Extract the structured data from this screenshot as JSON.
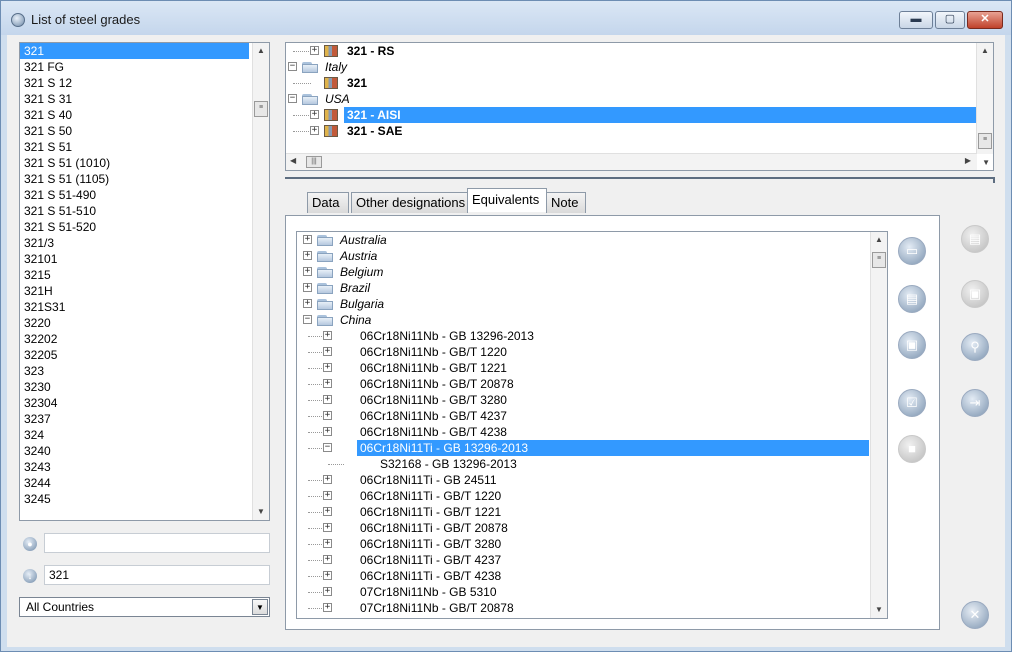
{
  "window": {
    "title": "List of steel grades",
    "controls": {
      "minimize": "▬",
      "maximize": "▢",
      "close": "✕"
    }
  },
  "grades_list": {
    "selected": "321",
    "items": [
      "321",
      "321 FG",
      "321 S 12",
      "321 S 31",
      "321 S 40",
      "321 S 50",
      "321 S 51",
      "321 S 51 (1010)",
      "321 S 51 (1105)",
      "321 S 51-490",
      "321 S 51-510",
      "321 S 51-520",
      "321/3",
      "32101",
      "3215",
      "321H",
      "321S31",
      "3220",
      "32202",
      "32205",
      "323",
      "3230",
      "32304",
      "3237",
      "324",
      "3240",
      "3243",
      "3244",
      "3245"
    ]
  },
  "search": {
    "icon": "magnifier-icon",
    "value": ""
  },
  "grade_field": {
    "icon": "down-arrow-icon",
    "value": "321"
  },
  "country_filter": {
    "value": "All Countries"
  },
  "designation_tree": {
    "nodes": [
      {
        "level": 1,
        "kind": "grade",
        "expanded": false,
        "text": "321  -  RS",
        "bold": true,
        "partial": true
      },
      {
        "level": 0,
        "kind": "country",
        "expanded": true,
        "text": "Italy",
        "italic": true
      },
      {
        "level": 1,
        "kind": "grade",
        "expanded": null,
        "text": "321",
        "bold": true
      },
      {
        "level": 0,
        "kind": "country",
        "expanded": true,
        "text": "USA",
        "italic": true
      },
      {
        "level": 1,
        "kind": "grade",
        "expanded": false,
        "text": "321  -  AISI",
        "bold": true,
        "selected": true
      },
      {
        "level": 1,
        "kind": "grade",
        "expanded": false,
        "text": "321  -  SAE",
        "bold": true
      }
    ]
  },
  "tabs": [
    {
      "label": "Data",
      "active": false
    },
    {
      "label": "Other designations",
      "active": false
    },
    {
      "label": "Equivalents",
      "active": true
    },
    {
      "label": "Note",
      "active": false
    }
  ],
  "equivalents_tree": {
    "nodes": [
      {
        "level": 0,
        "kind": "country",
        "expanded": false,
        "text": "Australia"
      },
      {
        "level": 0,
        "kind": "country",
        "expanded": false,
        "text": "Austria"
      },
      {
        "level": 0,
        "kind": "country",
        "expanded": false,
        "text": "Belgium"
      },
      {
        "level": 0,
        "kind": "country",
        "expanded": false,
        "text": "Brazil"
      },
      {
        "level": 0,
        "kind": "country",
        "expanded": false,
        "text": "Bulgaria"
      },
      {
        "level": 0,
        "kind": "country",
        "expanded": true,
        "text": "China"
      },
      {
        "level": 1,
        "kind": "grade",
        "expanded": false,
        "text": "06Cr18Ni11Nb  -  GB 13296-2013"
      },
      {
        "level": 1,
        "kind": "grade",
        "expanded": false,
        "text": "06Cr18Ni11Nb  -  GB/T 1220"
      },
      {
        "level": 1,
        "kind": "grade",
        "expanded": false,
        "text": "06Cr18Ni11Nb  -  GB/T 1221"
      },
      {
        "level": 1,
        "kind": "grade",
        "expanded": false,
        "text": "06Cr18Ni11Nb  -  GB/T 20878"
      },
      {
        "level": 1,
        "kind": "grade",
        "expanded": false,
        "text": "06Cr18Ni11Nb  -  GB/T 3280"
      },
      {
        "level": 1,
        "kind": "grade",
        "expanded": false,
        "text": "06Cr18Ni11Nb  -  GB/T 4237"
      },
      {
        "level": 1,
        "kind": "grade",
        "expanded": false,
        "text": "06Cr18Ni11Nb  -  GB/T 4238"
      },
      {
        "level": 1,
        "kind": "grade",
        "expanded": true,
        "text": "06Cr18Ni11Ti  -  GB 13296-2013",
        "selected": true
      },
      {
        "level": 2,
        "kind": "child",
        "expanded": null,
        "text": "S32168  -  GB 13296-2013"
      },
      {
        "level": 1,
        "kind": "grade",
        "expanded": false,
        "text": "06Cr18Ni11Ti  -  GB 24511"
      },
      {
        "level": 1,
        "kind": "grade",
        "expanded": false,
        "text": "06Cr18Ni11Ti  -  GB/T 1220"
      },
      {
        "level": 1,
        "kind": "grade",
        "expanded": false,
        "text": "06Cr18Ni11Ti  -  GB/T 1221"
      },
      {
        "level": 1,
        "kind": "grade",
        "expanded": false,
        "text": "06Cr18Ni11Ti  -  GB/T 20878"
      },
      {
        "level": 1,
        "kind": "grade",
        "expanded": false,
        "text": "06Cr18Ni11Ti  -  GB/T 3280"
      },
      {
        "level": 1,
        "kind": "grade",
        "expanded": false,
        "text": "06Cr18Ni11Ti  -  GB/T 4237"
      },
      {
        "level": 1,
        "kind": "grade",
        "expanded": false,
        "text": "06Cr18Ni11Ti  -  GB/T 4238"
      },
      {
        "level": 1,
        "kind": "grade",
        "expanded": false,
        "text": "07Cr18Ni11Nb  -  GB 5310"
      },
      {
        "level": 1,
        "kind": "grade",
        "expanded": false,
        "text": "07Cr18Ni11Nb  -  GB/T 20878"
      }
    ]
  },
  "panel_buttons": [
    {
      "name": "open-folder-button",
      "icon": "folder-open-icon",
      "glyph": "▭",
      "enabled": true
    },
    {
      "name": "print-button",
      "icon": "printer-icon",
      "glyph": "▤",
      "enabled": true
    },
    {
      "name": "save-button",
      "icon": "floppy-disk-icon",
      "glyph": "▣",
      "enabled": true
    },
    {
      "name": "check-button",
      "icon": "checkbox-icon",
      "glyph": "☑",
      "enabled": true
    },
    {
      "name": "stop-button",
      "icon": "stop-icon",
      "glyph": "■",
      "enabled": false
    }
  ],
  "side_buttons": [
    {
      "name": "print-side-button",
      "icon": "printer-icon",
      "glyph": "▤",
      "enabled": false
    },
    {
      "name": "save-side-button",
      "icon": "floppy-disk-icon",
      "glyph": "▣",
      "enabled": false
    },
    {
      "name": "search-side-button",
      "icon": "magnifier-icon",
      "glyph": "⚲",
      "enabled": true
    },
    {
      "name": "export-side-button",
      "icon": "export-document-icon",
      "glyph": "⇥",
      "enabled": true
    }
  ],
  "exit_button": {
    "icon": "close-icon",
    "glyph": "✕"
  },
  "colors": {
    "selection": "#3399ff",
    "window_frame": "#cfdeee",
    "close_button": "#c0422b"
  }
}
